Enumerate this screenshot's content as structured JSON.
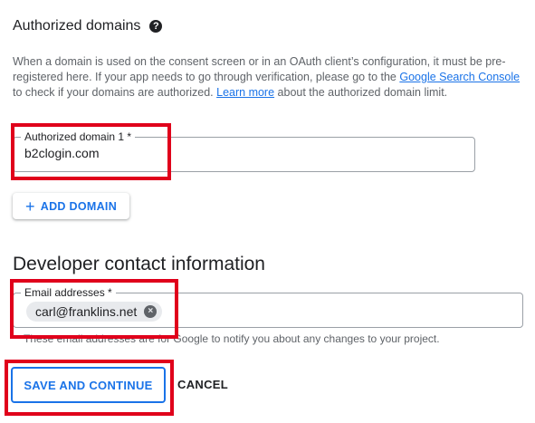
{
  "authorized_domains": {
    "title": "Authorized domains",
    "help_icon": "question-circle-icon",
    "description_part1": "When a domain is used on the consent screen or in an OAuth client’s configuration, it must be pre-registered here. If your app needs to go through verification, please go to the ",
    "search_console_link": "Google Search Console",
    "description_part2": " to check if your domains are authorized. ",
    "learn_more_link": "Learn more",
    "description_part3": " about the authorized domain limit.",
    "domain_field_label": "Authorized domain 1 *",
    "domain_field_value": "b2clogin.com",
    "add_domain_icon": "plus-icon",
    "add_domain_label": "ADD DOMAIN"
  },
  "developer_contact": {
    "title": "Developer contact information",
    "email_field_label": "Email addresses *",
    "email_chip": "carl@franklins.net",
    "chip_remove_icon": "close-circle-icon",
    "helper_text": "These email addresses are for Google to notify you about any changes to your project."
  },
  "actions": {
    "save_label": "SAVE AND CONTINUE",
    "cancel_label": "CANCEL"
  },
  "colors": {
    "accent": "#1a73e8",
    "highlight": "#e0001b",
    "text": "#202124",
    "muted": "#5f6368"
  }
}
